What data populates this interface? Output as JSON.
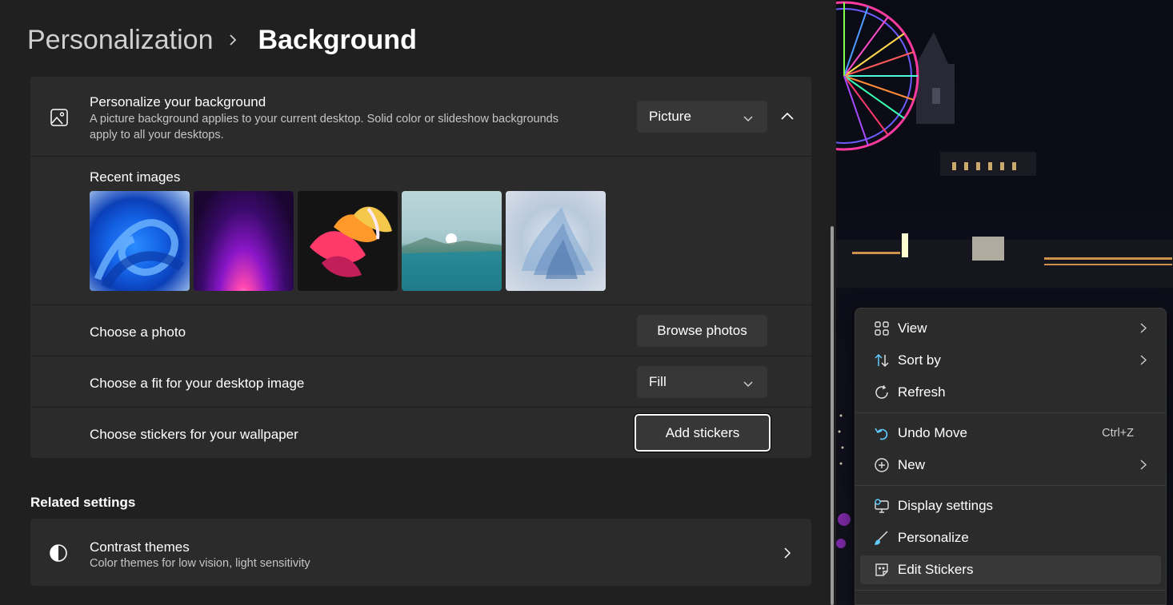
{
  "breadcrumb": {
    "parent": "Personalization",
    "current": "Background"
  },
  "personalize": {
    "title": "Personalize your background",
    "desc_line1": "A picture background applies to your current desktop. Solid color or slideshow backgrounds",
    "desc_line2": "apply to all your desktops.",
    "dropdown_value": "Picture"
  },
  "recent": {
    "label": "Recent images"
  },
  "choose_photo": {
    "label": "Choose a photo",
    "button": "Browse photos"
  },
  "fit": {
    "label": "Choose a fit for your desktop image",
    "value": "Fill"
  },
  "stickers": {
    "label": "Choose stickers for your wallpaper",
    "button": "Add stickers"
  },
  "related": {
    "heading": "Related settings",
    "contrast_title": "Contrast themes",
    "contrast_desc": "Color themes for low vision, light sensitivity"
  },
  "context_menu": {
    "view": "View",
    "sort_by": "Sort by",
    "refresh": "Refresh",
    "undo_move": "Undo Move",
    "undo_shortcut": "Ctrl+Z",
    "new": "New",
    "display_settings": "Display settings",
    "personalize": "Personalize",
    "edit_stickers": "Edit Stickers"
  },
  "colors": {
    "window_bg": "#202020",
    "card_bg": "#2b2b2b",
    "control_bg": "#373737",
    "accent": "#60cdff"
  }
}
